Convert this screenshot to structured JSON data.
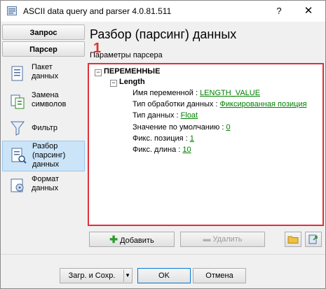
{
  "window": {
    "title": "ASCII data query and parser 4.0.81.511",
    "help": "?",
    "close": "✕"
  },
  "nav": {
    "zapros": "Запрос",
    "parser": "Парсер"
  },
  "sidebar": {
    "items": [
      {
        "label": "Пакет\nданных",
        "icon": "packet-icon"
      },
      {
        "label": "Замена\nсимволов",
        "icon": "replace-icon"
      },
      {
        "label": "Фильтр",
        "icon": "filter-icon"
      },
      {
        "label": "Разбор\n(парсинг)\nданных",
        "icon": "parser-icon",
        "active": true
      },
      {
        "label": "Формат\nданных",
        "icon": "format-icon"
      }
    ]
  },
  "main": {
    "title": "Разбор (парсинг) данных",
    "group_label": "Параметры парсера",
    "badge": "1",
    "tree": {
      "root": "ПЕРЕМЕННЫЕ",
      "variable": "Length",
      "props": [
        {
          "label": "Имя переменной : ",
          "value": "LENGTH_VALUE"
        },
        {
          "label": "Тип обработки данных : ",
          "value": "Фиксированная позиция"
        },
        {
          "label": "Тип данных : ",
          "value": "Float"
        },
        {
          "label": "Значение по умолчанию : ",
          "value": "0"
        },
        {
          "label": "Фикс. позиция : ",
          "value": "1"
        },
        {
          "label": "Фикс. длина : ",
          "value": "10"
        }
      ]
    },
    "buttons": {
      "add": "Добавить",
      "delete": "Удалить"
    }
  },
  "footer": {
    "load_save": "Загр. и Сохр.",
    "ok": "OK",
    "cancel": "Отмена"
  },
  "colors": {
    "accent_red": "#e0303a",
    "link_green": "#008000",
    "active_bg": "#cce4f7"
  }
}
